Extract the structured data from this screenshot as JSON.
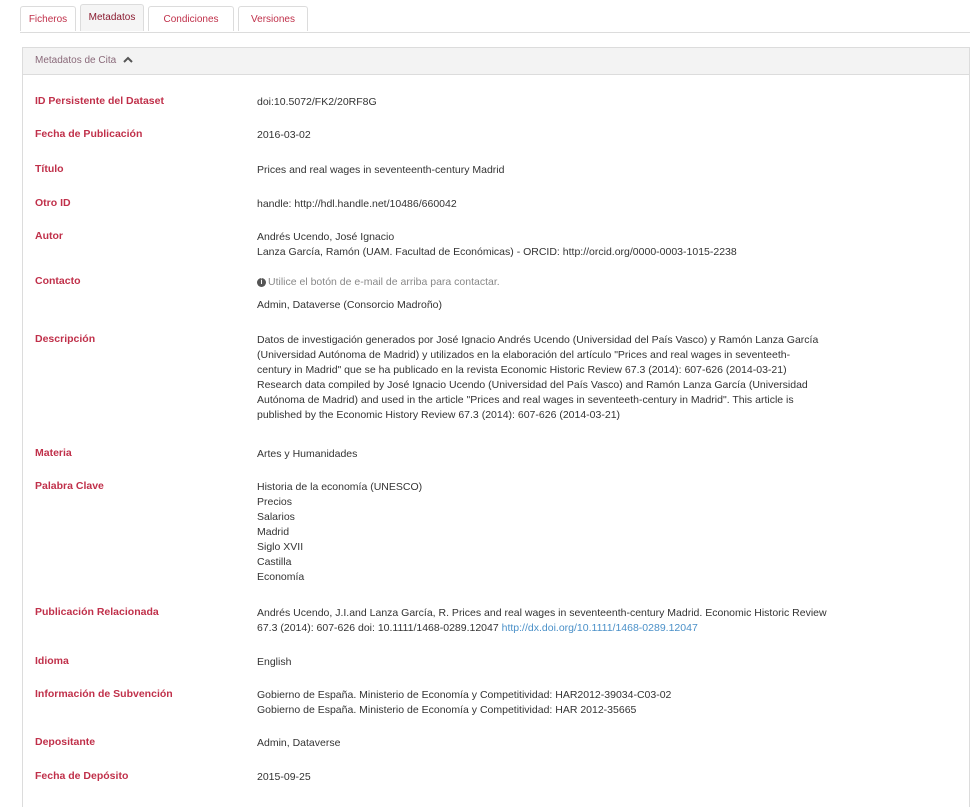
{
  "tabs": [
    {
      "label": "Ficheros"
    },
    {
      "label": "Metadatos"
    },
    {
      "label": "Condiciones"
    },
    {
      "label": "Versiones"
    }
  ],
  "panel": {
    "title": "Metadatos de Cita"
  },
  "fields": {
    "persistent_id": {
      "label": "ID Persistente del Dataset",
      "value": "doi:10.5072/FK2/20RF8G"
    },
    "pub_date": {
      "label": "Fecha de Publicación",
      "value": "2016-03-02"
    },
    "title": {
      "label": "Título",
      "value": "Prices and real wages in seventeenth-century Madrid"
    },
    "other_id": {
      "label": "Otro ID",
      "value": "handle: http://hdl.handle.net/10486/660042"
    },
    "author": {
      "label": "Autor",
      "lines": [
        "Andrés Ucendo, José Ignacio",
        "Lanza García, Ramón (UAM. Facultad de Económicas) - ORCID: http://orcid.org/0000-0003-1015-2238"
      ]
    },
    "contact": {
      "label": "Contacto",
      "notice": "Utilice el botón de e-mail de arriba para contactar.",
      "value": "Admin, Dataverse (Consorcio Madroño)"
    },
    "description": {
      "label": "Descripción",
      "lines": [
        "Datos de investigación generados por José Ignacio Andrés Ucendo (Universidad del País Vasco) y Ramón Lanza García",
        "(Universidad Autónoma de Madrid) y utilizados en la elaboración del artículo \"Prices and real wages in seventeeth-",
        "century in Madrid\" que se ha publicado en la revista Economic Historic Review 67.3 (2014): 607-626 (2014-03-21)",
        "Research data compiled by José Ignacio Ucendo (Universidad del País Vasco) and Ramón Lanza García (Universidad",
        "Autónoma de Madrid) and used in the article \"Prices and real wages in seventeeth-century in Madrid\". This article is",
        "published by the Economic History Review 67.3 (2014): 607-626 (2014-03-21)"
      ]
    },
    "subject": {
      "label": "Materia",
      "value": "Artes y Humanidades"
    },
    "keywords": {
      "label": "Palabra Clave",
      "items": [
        "Historia de la economía (UNESCO)",
        "Precios",
        "Salarios",
        "Madrid",
        "Siglo XVII",
        "Castilla",
        "Economía"
      ]
    },
    "related_pub": {
      "label": "Publicación Relacionada",
      "line1": "Andrés Ucendo, J.I.and Lanza García, R. Prices and real wages in seventeenth-century Madrid. Economic Historic Review",
      "line2": "67.3 (2014): 607-626 doi: 10.1111/1468-0289.12047 ",
      "link": "http://dx.doi.org/10.1111/1468-0289.12047"
    },
    "language": {
      "label": "Idioma",
      "value": "English"
    },
    "grant": {
      "label": "Información de Subvención",
      "lines": [
        "Gobierno de España. Ministerio de Economía y Competitividad: HAR2012-39034-C03-02",
        "Gobierno de España. Ministerio de Economía y Competitividad: HAR 2012-35665"
      ]
    },
    "depositor": {
      "label": "Depositante",
      "value": "Admin, Dataverse"
    },
    "deposit_date": {
      "label": "Fecha de Depósito",
      "value": "2015-09-25"
    }
  }
}
